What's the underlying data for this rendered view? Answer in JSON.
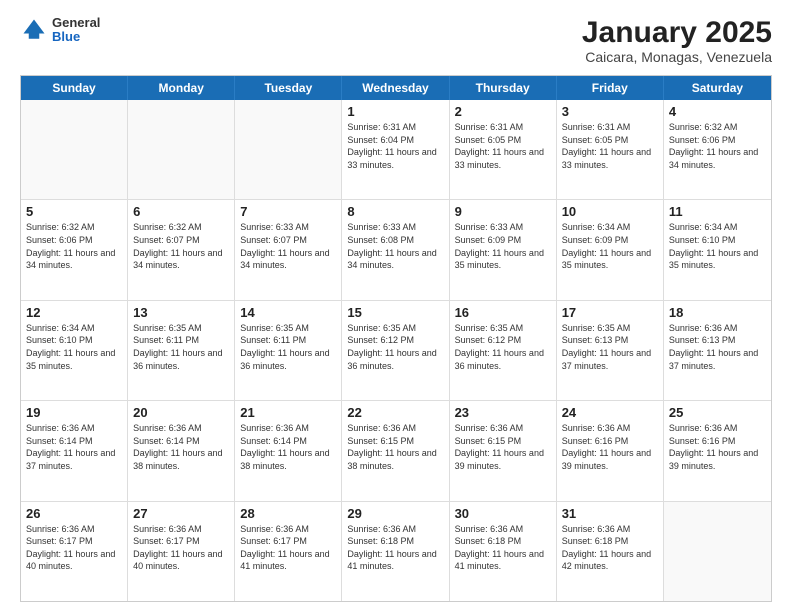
{
  "header": {
    "logo": {
      "general": "General",
      "blue": "Blue"
    },
    "title": "January 2025",
    "subtitle": "Caicara, Monagas, Venezuela"
  },
  "calendar": {
    "weekdays": [
      "Sunday",
      "Monday",
      "Tuesday",
      "Wednesday",
      "Thursday",
      "Friday",
      "Saturday"
    ],
    "weeks": [
      [
        {
          "day": "",
          "empty": true
        },
        {
          "day": "",
          "empty": true
        },
        {
          "day": "",
          "empty": true
        },
        {
          "day": "1",
          "sunrise": "6:31 AM",
          "sunset": "6:04 PM",
          "daylight": "11 hours and 33 minutes."
        },
        {
          "day": "2",
          "sunrise": "6:31 AM",
          "sunset": "6:05 PM",
          "daylight": "11 hours and 33 minutes."
        },
        {
          "day": "3",
          "sunrise": "6:31 AM",
          "sunset": "6:05 PM",
          "daylight": "11 hours and 33 minutes."
        },
        {
          "day": "4",
          "sunrise": "6:32 AM",
          "sunset": "6:06 PM",
          "daylight": "11 hours and 34 minutes."
        }
      ],
      [
        {
          "day": "5",
          "sunrise": "6:32 AM",
          "sunset": "6:06 PM",
          "daylight": "11 hours and 34 minutes."
        },
        {
          "day": "6",
          "sunrise": "6:32 AM",
          "sunset": "6:07 PM",
          "daylight": "11 hours and 34 minutes."
        },
        {
          "day": "7",
          "sunrise": "6:33 AM",
          "sunset": "6:07 PM",
          "daylight": "11 hours and 34 minutes."
        },
        {
          "day": "8",
          "sunrise": "6:33 AM",
          "sunset": "6:08 PM",
          "daylight": "11 hours and 34 minutes."
        },
        {
          "day": "9",
          "sunrise": "6:33 AM",
          "sunset": "6:09 PM",
          "daylight": "11 hours and 35 minutes."
        },
        {
          "day": "10",
          "sunrise": "6:34 AM",
          "sunset": "6:09 PM",
          "daylight": "11 hours and 35 minutes."
        },
        {
          "day": "11",
          "sunrise": "6:34 AM",
          "sunset": "6:10 PM",
          "daylight": "11 hours and 35 minutes."
        }
      ],
      [
        {
          "day": "12",
          "sunrise": "6:34 AM",
          "sunset": "6:10 PM",
          "daylight": "11 hours and 35 minutes."
        },
        {
          "day": "13",
          "sunrise": "6:35 AM",
          "sunset": "6:11 PM",
          "daylight": "11 hours and 36 minutes."
        },
        {
          "day": "14",
          "sunrise": "6:35 AM",
          "sunset": "6:11 PM",
          "daylight": "11 hours and 36 minutes."
        },
        {
          "day": "15",
          "sunrise": "6:35 AM",
          "sunset": "6:12 PM",
          "daylight": "11 hours and 36 minutes."
        },
        {
          "day": "16",
          "sunrise": "6:35 AM",
          "sunset": "6:12 PM",
          "daylight": "11 hours and 36 minutes."
        },
        {
          "day": "17",
          "sunrise": "6:35 AM",
          "sunset": "6:13 PM",
          "daylight": "11 hours and 37 minutes."
        },
        {
          "day": "18",
          "sunrise": "6:36 AM",
          "sunset": "6:13 PM",
          "daylight": "11 hours and 37 minutes."
        }
      ],
      [
        {
          "day": "19",
          "sunrise": "6:36 AM",
          "sunset": "6:14 PM",
          "daylight": "11 hours and 37 minutes."
        },
        {
          "day": "20",
          "sunrise": "6:36 AM",
          "sunset": "6:14 PM",
          "daylight": "11 hours and 38 minutes."
        },
        {
          "day": "21",
          "sunrise": "6:36 AM",
          "sunset": "6:14 PM",
          "daylight": "11 hours and 38 minutes."
        },
        {
          "day": "22",
          "sunrise": "6:36 AM",
          "sunset": "6:15 PM",
          "daylight": "11 hours and 38 minutes."
        },
        {
          "day": "23",
          "sunrise": "6:36 AM",
          "sunset": "6:15 PM",
          "daylight": "11 hours and 39 minutes."
        },
        {
          "day": "24",
          "sunrise": "6:36 AM",
          "sunset": "6:16 PM",
          "daylight": "11 hours and 39 minutes."
        },
        {
          "day": "25",
          "sunrise": "6:36 AM",
          "sunset": "6:16 PM",
          "daylight": "11 hours and 39 minutes."
        }
      ],
      [
        {
          "day": "26",
          "sunrise": "6:36 AM",
          "sunset": "6:17 PM",
          "daylight": "11 hours and 40 minutes."
        },
        {
          "day": "27",
          "sunrise": "6:36 AM",
          "sunset": "6:17 PM",
          "daylight": "11 hours and 40 minutes."
        },
        {
          "day": "28",
          "sunrise": "6:36 AM",
          "sunset": "6:17 PM",
          "daylight": "11 hours and 41 minutes."
        },
        {
          "day": "29",
          "sunrise": "6:36 AM",
          "sunset": "6:18 PM",
          "daylight": "11 hours and 41 minutes."
        },
        {
          "day": "30",
          "sunrise": "6:36 AM",
          "sunset": "6:18 PM",
          "daylight": "11 hours and 41 minutes."
        },
        {
          "day": "31",
          "sunrise": "6:36 AM",
          "sunset": "6:18 PM",
          "daylight": "11 hours and 42 minutes."
        },
        {
          "day": "",
          "empty": true
        }
      ]
    ]
  }
}
